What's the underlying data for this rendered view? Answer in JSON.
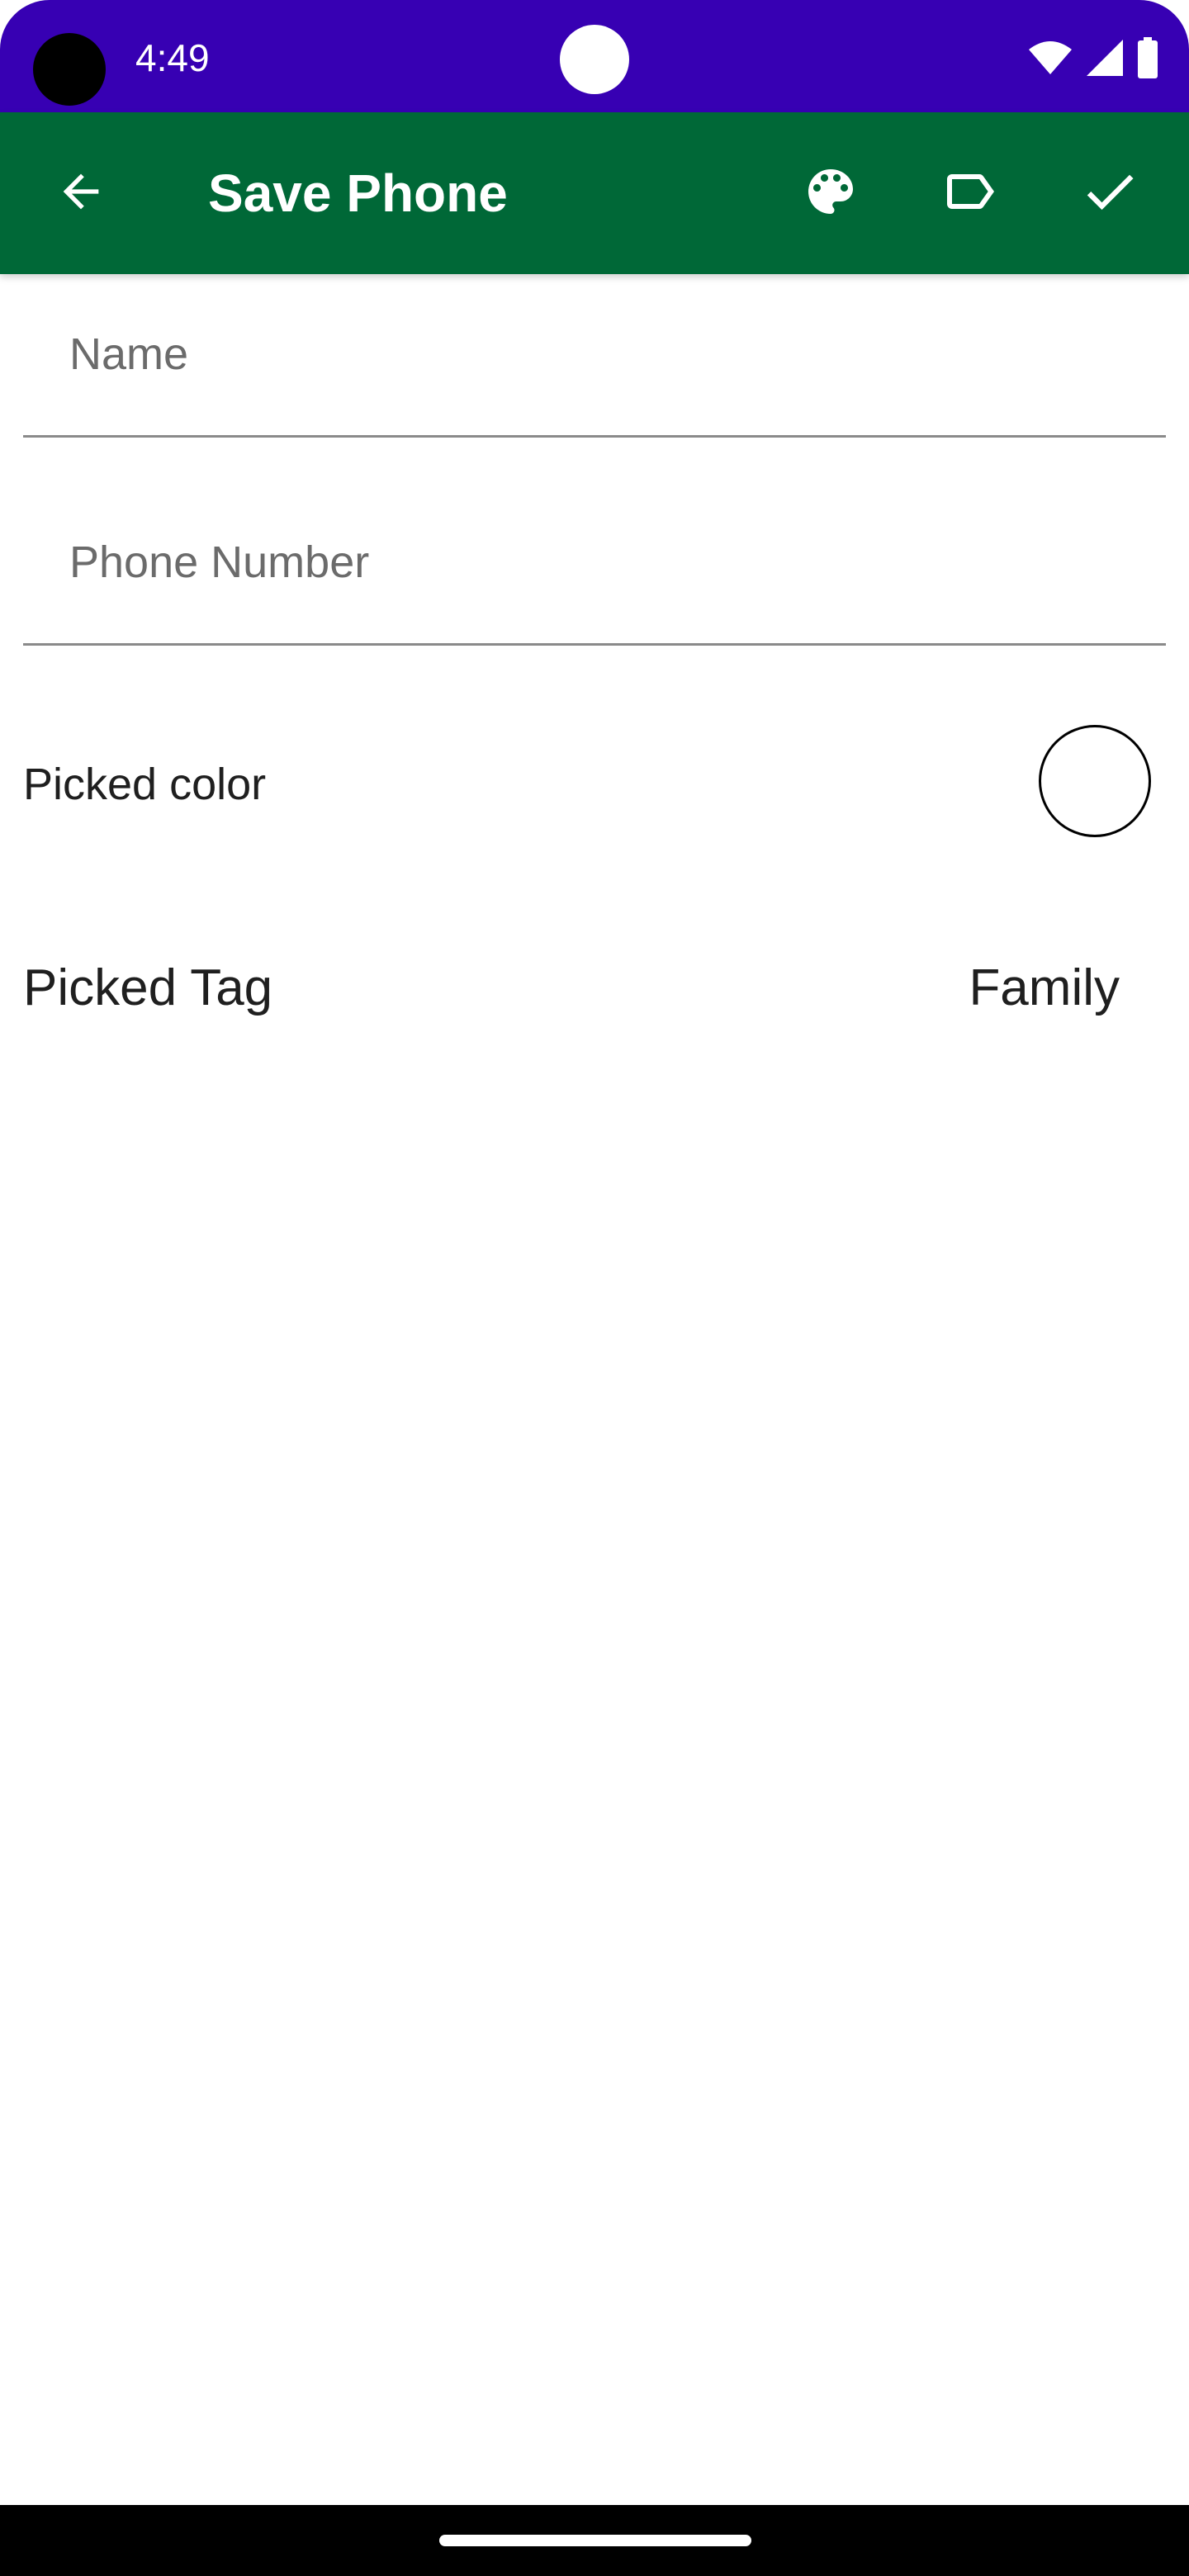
{
  "status_bar": {
    "time": "4:49",
    "background_color": "#3700b3",
    "icons": [
      "wifi-icon",
      "signal-icon",
      "battery-icon"
    ]
  },
  "app_bar": {
    "title": "Save Phone",
    "background_color": "#006837",
    "actions": [
      "arrow-back-icon",
      "palette-icon",
      "label-icon",
      "check-icon"
    ]
  },
  "form": {
    "name": {
      "value": "",
      "placeholder": "Name"
    },
    "phone": {
      "value": "",
      "placeholder": "Phone Number"
    }
  },
  "color_row": {
    "label": "Picked color",
    "selected_color": "#ffffff"
  },
  "tag_row": {
    "label": "Picked Tag",
    "value": "Family"
  }
}
